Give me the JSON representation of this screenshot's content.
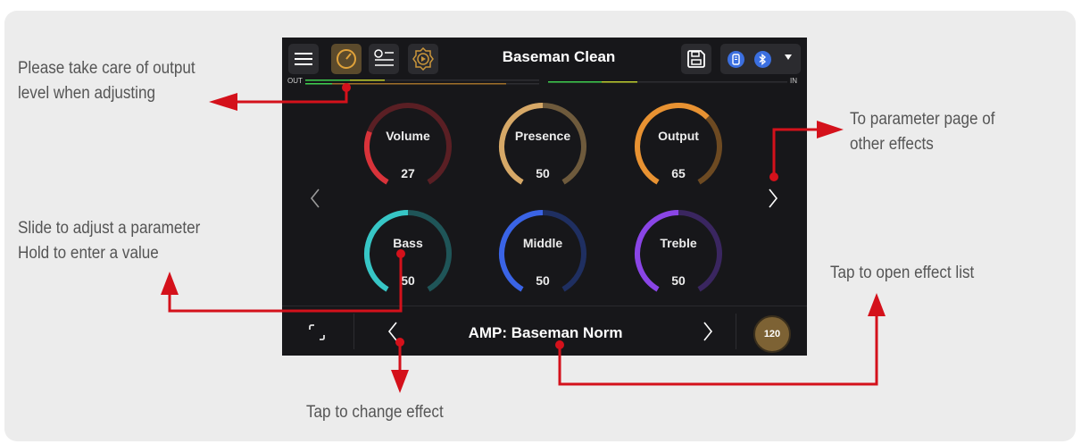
{
  "app": {
    "preset_name": "Baseman Clean",
    "meter": {
      "out_label": "OUT",
      "in_label": "IN"
    },
    "knobs": [
      {
        "name": "Volume",
        "value": "27",
        "track": "#5a1f24",
        "fill": "#d8333a",
        "fraction": 0.27
      },
      {
        "name": "Presence",
        "value": "50",
        "track": "#6e5a3c",
        "fill": "#d6a867",
        "fraction": 0.5
      },
      {
        "name": "Output",
        "value": "65",
        "track": "#6d4a22",
        "fill": "#e89232",
        "fraction": 0.65
      },
      {
        "name": "Bass",
        "value": "50",
        "track": "#1f5558",
        "fill": "#37c6c6",
        "fraction": 0.5
      },
      {
        "name": "Middle",
        "value": "50",
        "track": "#1f2f61",
        "fill": "#3a64e6",
        "fraction": 0.5
      },
      {
        "name": "Treble",
        "value": "50",
        "track": "#3a2660",
        "fill": "#8a45e6",
        "fraction": 0.5
      }
    ],
    "effect_name": "AMP: Baseman Norm",
    "bpm": "120",
    "icons": [
      "menu-icon",
      "knob-icon",
      "list-icon",
      "play-icon",
      "save-icon",
      "phone-icon",
      "bluetooth-icon",
      "chevron-left-icon",
      "chevron-right-icon",
      "expand-icon"
    ]
  },
  "annotations": {
    "output_level": [
      "Please take care of output",
      "level when adjusting"
    ],
    "param_page": [
      "To parameter page of",
      "other effects"
    ],
    "slide_adjust": [
      "Slide to adjust a parameter",
      "Hold to enter a value"
    ],
    "open_list": [
      "Tap to open effect list"
    ],
    "change_effect": [
      "Tap to change effect"
    ],
    "arrow_color": "#d4111b"
  }
}
